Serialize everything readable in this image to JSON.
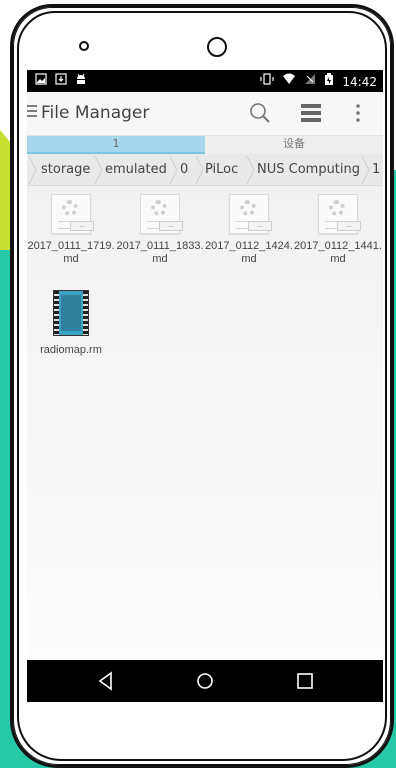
{
  "status_bar": {
    "time": "14:42",
    "icons": [
      "image-icon",
      "download-icon",
      "android-icon",
      "vibrate-icon",
      "wifi-icon",
      "no-signal-icon",
      "battery-icon"
    ]
  },
  "app": {
    "title": "File Manager",
    "actions": [
      "search-icon",
      "storage-icon",
      "overflow-icon"
    ]
  },
  "tabs": [
    {
      "label": "1",
      "active": true
    },
    {
      "label": "设备",
      "active": false
    }
  ],
  "breadcrumb": [
    "storage",
    "emulated",
    "0",
    "PiLoc",
    "NUS Computing",
    "1"
  ],
  "files": [
    {
      "name": "2017_0111_1719.md",
      "type": "document",
      "badge": "..."
    },
    {
      "name": "2017_0111_1833.md",
      "type": "document",
      "badge": "..."
    },
    {
      "name": "2017_0112_1424.md",
      "type": "document",
      "badge": "..."
    },
    {
      "name": "2017_0112_1441.md",
      "type": "document",
      "badge": "..."
    },
    {
      "name": "radiomap.rm",
      "type": "video"
    }
  ],
  "nav": [
    "back-icon",
    "home-icon",
    "recents-icon"
  ],
  "colors": {
    "tab_active": "#a7d7ec",
    "background_teal": "#27c8a8",
    "background_lime": "#c8e032"
  }
}
